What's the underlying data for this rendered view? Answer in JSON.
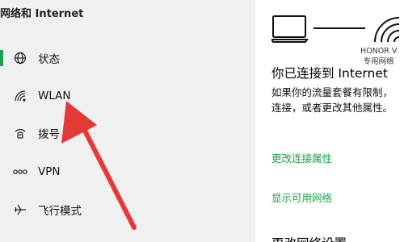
{
  "sidebar": {
    "title": "网络和 Internet",
    "items": [
      {
        "label": "状态",
        "icon": "globe-icon",
        "active": true
      },
      {
        "label": "WLAN",
        "icon": "wifi-icon",
        "active": false
      },
      {
        "label": "拨号",
        "icon": "dialup-icon",
        "active": false
      },
      {
        "label": "VPN",
        "icon": "vpn-icon",
        "active": false
      },
      {
        "label": "飞行模式",
        "icon": "airplane-icon",
        "active": false
      }
    ]
  },
  "main": {
    "network_name_line1": "HONOR V",
    "network_name_line2": "专用网络",
    "connected_title": "你已连接到 Internet",
    "description_line1": "如果你的流量套餐有限制，",
    "description_line2": "连接，或者更改其他属性。",
    "link_change_properties": "更改连接属性",
    "link_show_networks": "显示可用网络",
    "next_section": "更改网络设置"
  },
  "colors": {
    "accent": "#16a34a",
    "annotation_arrow": "#e53935"
  }
}
